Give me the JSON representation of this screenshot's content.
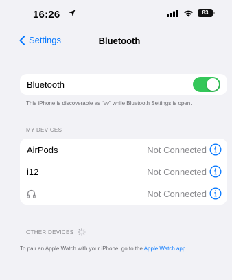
{
  "status_bar": {
    "time": "16:26",
    "battery": "83"
  },
  "nav": {
    "back_label": "Settings",
    "title": "Bluetooth"
  },
  "bluetooth": {
    "label": "Bluetooth",
    "enabled": true,
    "discoverable_note": "This iPhone is discoverable as “vv” while Bluetooth Settings is open."
  },
  "my_devices": {
    "header": "MY DEVICES",
    "items": [
      {
        "name": "AirPods",
        "status": "Not Connected"
      },
      {
        "name": "i12",
        "status": "Not Connected"
      },
      {
        "name": "",
        "icon": "headphones-icon",
        "status": "Not Connected"
      }
    ]
  },
  "other_devices": {
    "header": "OTHER DEVICES"
  },
  "footer": {
    "text": "To pair an Apple Watch with your iPhone, go to the ",
    "link": "Apple Watch app",
    "end": "."
  },
  "colors": {
    "accent": "#0a7aff",
    "toggle_on": "#34c759",
    "background": "#f2f2f6"
  }
}
